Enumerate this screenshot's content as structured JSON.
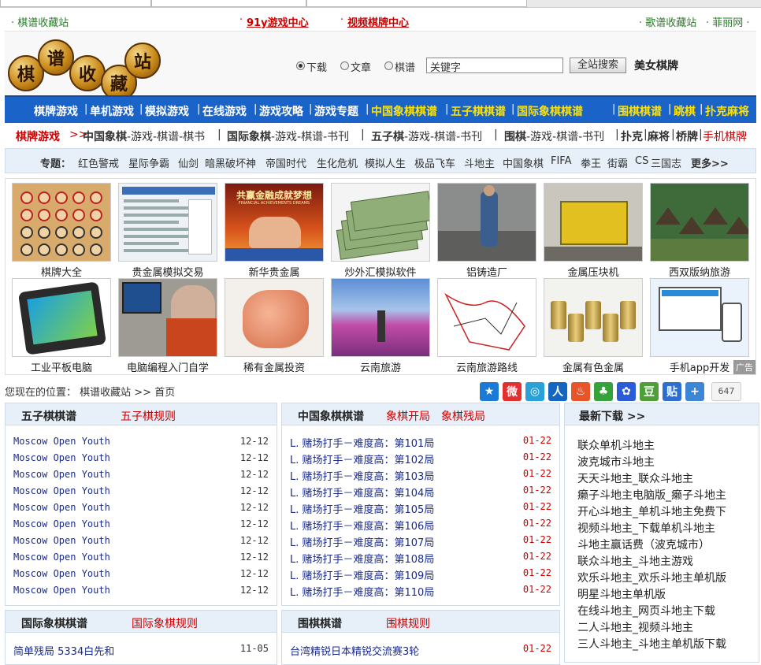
{
  "top_links": {
    "left": "· 棋谱收藏站",
    "center1": "91y游戏中心",
    "center2": "视频棋牌中心",
    "right1": "· 歌谱收藏站",
    "right2": "· 菲丽网 ·"
  },
  "logo_chars": [
    "棋",
    "谱",
    "收",
    "藏",
    "站"
  ],
  "search": {
    "options": [
      "下载",
      "文章",
      "棋谱"
    ],
    "selected": "下载",
    "input_value": "关键字",
    "button": "全站搜索",
    "extra_link": "美女棋牌"
  },
  "main_nav": [
    {
      "label": "棋牌游戏",
      "hl": false
    },
    {
      "label": "单机游戏",
      "hl": false
    },
    {
      "label": "模拟游戏",
      "hl": false
    },
    {
      "label": "在线游戏",
      "hl": false
    },
    {
      "label": "游戏攻略",
      "hl": false
    },
    {
      "label": "游戏专题",
      "hl": false
    },
    {
      "label": "中国象棋棋谱",
      "hl": true
    },
    {
      "label": "五子棋棋谱",
      "hl": true
    },
    {
      "label": "国际象棋棋谱",
      "hl": true
    },
    {
      "label": "围棋棋谱",
      "hl": true
    },
    {
      "label": "跳棋",
      "hl": true
    },
    {
      "label": "扑克麻将",
      "hl": true
    }
  ],
  "subnav": {
    "lead": "棋牌游戏",
    "arrow": ">>",
    "groups": [
      {
        "bold": "中国象棋",
        "rest": "-游戏-棋谱-棋书"
      },
      {
        "bold": "国际象棋",
        "rest": "-游戏-棋谱-书刊"
      },
      {
        "bold": "五子棋",
        "rest": "-游戏-棋谱-书刊"
      },
      {
        "bold": "围棋",
        "rest": "-游戏-棋谱-书刊"
      }
    ],
    "tail": [
      "扑克",
      "麻将",
      "桥牌"
    ],
    "mobile": "手机棋牌"
  },
  "topics": {
    "label": "专题：",
    "items": [
      "红色警戒",
      "星际争霸",
      "仙剑",
      "暗黑破坏神",
      "帝国时代",
      "生化危机",
      "模拟人生",
      "极品飞车",
      "斗地主",
      "中国象棋",
      "FIFA",
      "拳王",
      "街霸",
      "CS",
      "三国志"
    ],
    "more": "更多>>"
  },
  "gallery": {
    "row1": [
      "棋牌大全",
      "贵金属模拟交易",
      "新华贵金属",
      "炒外汇模拟软件",
      "铝铸造厂",
      "金属压块机",
      "西双版纳旅游"
    ],
    "row2": [
      "工业平板电脑",
      "电脑编程入门自学",
      "稀有金属投资",
      "云南旅游",
      "云南旅游路线",
      "金属有色金属",
      "手机app开发"
    ],
    "ad_label": "广告",
    "img_text_1": "共赢金融成就梦想",
    "img_text_2": "FINANCIAL ACHIEVEMENTS DREAMS"
  },
  "location": {
    "label": "您现在的位置：",
    "path": "棋谱收藏站 >> 首页"
  },
  "share": {
    "icons": [
      "qzone-icon",
      "weibo-icon",
      "tencent-weibo-icon",
      "renren-icon",
      "kaixin-icon",
      "clover-icon",
      "baidu-icon",
      "douban-icon",
      "tieba-icon",
      "more-share-icon"
    ],
    "colors": [
      "#1b7ad6",
      "#e0302f",
      "#2aa0d8",
      "#1466c0",
      "#e8542a",
      "#35a33a",
      "#2a5cd8",
      "#4e9e3a",
      "#2d6fd0",
      "#3d86d6"
    ],
    "count": "647"
  },
  "wuzi": {
    "title": "五子棋棋谱",
    "link": "五子棋规则",
    "items": [
      {
        "t": "Moscow Open Youth",
        "d": "12-12"
      },
      {
        "t": "Moscow Open Youth",
        "d": "12-12"
      },
      {
        "t": "Moscow Open Youth",
        "d": "12-12"
      },
      {
        "t": "Moscow Open Youth",
        "d": "12-12"
      },
      {
        "t": "Moscow Open Youth",
        "d": "12-12"
      },
      {
        "t": "Moscow Open Youth",
        "d": "12-12"
      },
      {
        "t": "Moscow Open Youth",
        "d": "12-12"
      },
      {
        "t": "Moscow Open Youth",
        "d": "12-12"
      },
      {
        "t": "Moscow Open Youth",
        "d": "12-12"
      },
      {
        "t": "Moscow Open Youth",
        "d": "12-12"
      }
    ]
  },
  "xiangqi": {
    "title": "中国象棋棋谱",
    "link1": "象棋开局",
    "link2": "象棋残局",
    "items": [
      {
        "t": "L. 赌场打手－难度高：第101局",
        "d": "01-22"
      },
      {
        "t": "L. 赌场打手－难度高：第102局",
        "d": "01-22"
      },
      {
        "t": "L. 赌场打手－难度高：第103局",
        "d": "01-22"
      },
      {
        "t": "L. 赌场打手－难度高：第104局",
        "d": "01-22"
      },
      {
        "t": "L. 赌场打手－难度高：第105局",
        "d": "01-22"
      },
      {
        "t": "L. 赌场打手－难度高：第106局",
        "d": "01-22"
      },
      {
        "t": "L. 赌场打手－难度高：第107局",
        "d": "01-22"
      },
      {
        "t": "L. 赌场打手－难度高：第108局",
        "d": "01-22"
      },
      {
        "t": "L. 赌场打手－难度高：第109局",
        "d": "01-22"
      },
      {
        "t": "L. 赌场打手－难度高：第110局",
        "d": "01-22"
      }
    ]
  },
  "downloads": {
    "title": "最新下载 >>",
    "items": [
      "联众单机斗地主",
      "波克城市斗地主",
      "天天斗地主_联众斗地主",
      "癞子斗地主电脑版_癞子斗地主",
      "开心斗地主_单机斗地主免费下",
      "视频斗地主_下载单机斗地主",
      "斗地主赢话费（波克城市）",
      "联众斗地主_斗地主游戏",
      "欢乐斗地主_欢乐斗地主单机版",
      "明星斗地主单机版",
      "在线斗地主_网页斗地主下载",
      "二人斗地主_视频斗地主",
      "三人斗地主_斗地主单机版下载"
    ]
  },
  "intl": {
    "title": "国际象棋棋谱",
    "link": "国际象棋规则",
    "first": {
      "t": "简单残局 5334白先和",
      "d": "11-05"
    }
  },
  "weiqi": {
    "title": "围棋棋谱",
    "link": "围棋规则",
    "first": {
      "t": "台湾精锐日本精锐交流赛3轮",
      "d": "01-22"
    }
  }
}
